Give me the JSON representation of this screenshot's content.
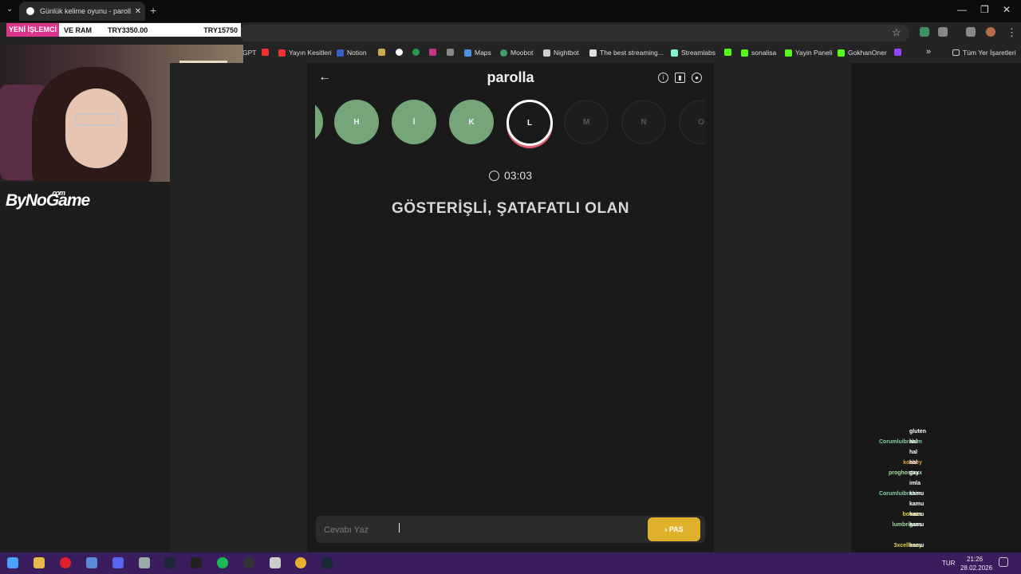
{
  "browser": {
    "tab_title": "Günlük kelime oyunu - parolla",
    "tab_close": "✕",
    "new_tab": "+",
    "tab_dropdown": "⌄",
    "window_controls": {
      "minimize": "—",
      "maximize": "❐",
      "close": "✕"
    },
    "bookmarks": [
      {
        "label": "GPT",
        "color": ""
      },
      {
        "label": "",
        "color": "#e33"
      },
      {
        "label": "Yayın Kesitleri",
        "color": "#e33"
      },
      {
        "label": "Notion",
        "color": "#3a5fc8"
      },
      {
        "label": "",
        "color": "#cca94a"
      },
      {
        "label": "",
        "color": "#fff"
      },
      {
        "label": "",
        "color": "#2a9a4a"
      },
      {
        "label": "",
        "color": "#c13584"
      },
      {
        "label": "",
        "color": "#888"
      },
      {
        "label": "Maps",
        "color": "#4a90e2"
      },
      {
        "label": "Moobot",
        "color": "#3fa06a"
      },
      {
        "label": "Nightbot",
        "color": "#ccc"
      },
      {
        "label": "The best streaming...",
        "color": "#ddd"
      },
      {
        "label": "Streamlabs",
        "color": "#80f5d2"
      },
      {
        "label": "",
        "color": "#53fc18"
      },
      {
        "label": "sonalisa",
        "color": "#53fc18"
      },
      {
        "label": "Yayin Paneli",
        "color": "#53fc18"
      },
      {
        "label": "GokhanOner",
        "color": "#53fc18"
      },
      {
        "label": "",
        "color": "#9146ff"
      }
    ],
    "bookmarks_more": "»",
    "all_bookmarks": "Tüm Yer İşaretleri"
  },
  "overlay": {
    "ticker_label": "YENİ İŞLEMCİ",
    "ticker_label2": "VE RAM",
    "ticker_value1": "TRY3350.00",
    "ticker_value2": "TRY15750",
    "brand": "ByNoGame",
    "brand_suffix": ".com"
  },
  "app": {
    "back_icon": "←",
    "logo": "parolla",
    "header_icons": [
      "info-icon",
      "stats-icon",
      "profile-icon"
    ],
    "letters": [
      {
        "char": "",
        "state": "done"
      },
      {
        "char": "H",
        "state": "done"
      },
      {
        "char": "İ",
        "state": "done"
      },
      {
        "char": "K",
        "state": "done"
      },
      {
        "char": "L",
        "state": "active"
      },
      {
        "char": "M",
        "state": "pending"
      },
      {
        "char": "N",
        "state": "pending"
      },
      {
        "char": "O",
        "state": "pending"
      }
    ],
    "timer": "03:03",
    "clue": "GÖSTERİŞLİ, ŞATAFATLI OLAN",
    "answer_placeholder": "Cevabı Yaz",
    "pass_button": "› PAS",
    "colors": {
      "done": "#76a57a",
      "active_ring": "#e05a6b",
      "pass": "#e0b12a"
    }
  },
  "chat": [
    {
      "user": "",
      "msg": "gluten",
      "color": "#e05050"
    },
    {
      "user": "Corumluibrahim",
      "msg": "hal",
      "color": "#7fd4a4"
    },
    {
      "user": "",
      "msg": "hal",
      "color": "#e05050"
    },
    {
      "user": "kozbey",
      "msg": "hal",
      "color": "#e0a030"
    },
    {
      "user": "proghostxxx",
      "msg": "gay",
      "color": "#a0e0a0"
    },
    {
      "user": "",
      "msg": "imla",
      "color": "#e05050"
    },
    {
      "user": "Corumluibrahim",
      "msg": "kamu",
      "color": "#7fd4a4"
    },
    {
      "user": "",
      "msg": "kamu",
      "color": "#e05050"
    },
    {
      "user": "boooze",
      "msg": "kamu",
      "color": "#e0d040"
    },
    {
      "user": "lumbrigass",
      "msg": "kamu",
      "color": "#a0e0a0"
    },
    {
      "user": "",
      "msg": "",
      "color": "#e05050"
    },
    {
      "user": "3xcellency",
      "msg": "kamu",
      "color": "#e0d040"
    },
    {
      "user": "kozbey",
      "msg": "kamu",
      "color": "#e0a030"
    }
  ],
  "taskbar": {
    "lang": "TUR",
    "time": "21:26",
    "date": "28.02.2026"
  }
}
